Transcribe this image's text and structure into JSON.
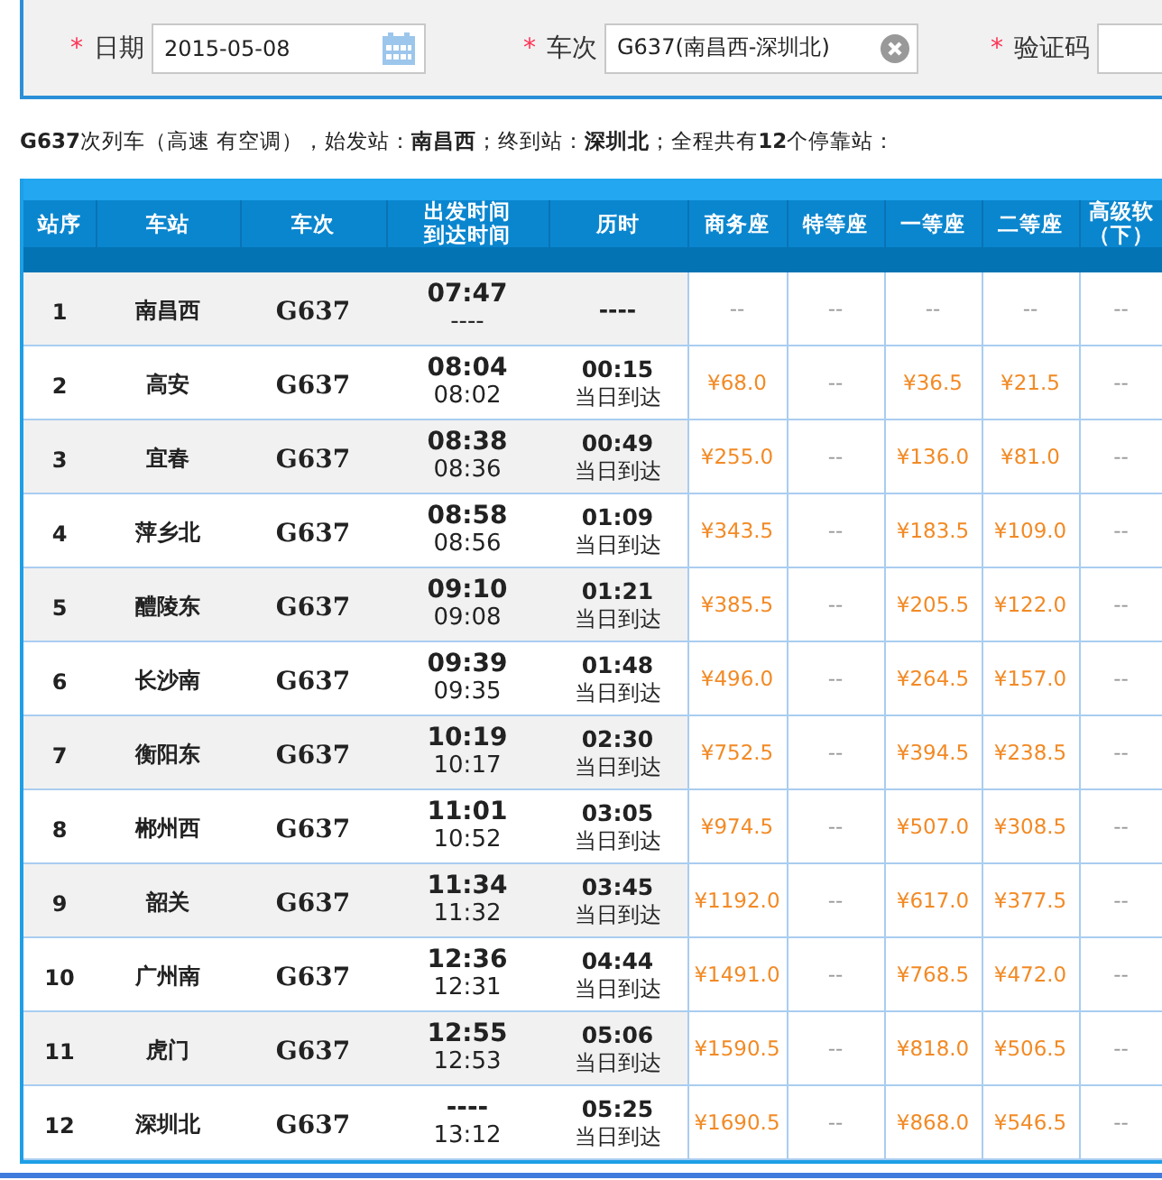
{
  "search_form": {
    "fields": [
      {
        "kind": "date",
        "label": "日期",
        "required_mark": "*",
        "value": "2015-05-08"
      },
      {
        "kind": "select",
        "label": "车次",
        "required_mark": "*",
        "value": "G637(南昌西-深圳北)"
      },
      {
        "kind": "captcha",
        "label": "验证码",
        "required_mark": "*"
      }
    ]
  },
  "summary": "**G637**次列车（高速 有空调），始发站：**南昌西**；终到站：**深圳北**；全程共有**12**个停靠站：",
  "table": {
    "columns": [
      {
        "label": "站序"
      },
      {
        "label": "车站"
      },
      {
        "label": "车次"
      },
      {
        "label": "出发时间",
        "label_2": "到达时间"
      },
      {
        "label": "历时"
      },
      {
        "label": "商务座"
      },
      {
        "label": "特等座"
      },
      {
        "label": "一等座"
      },
      {
        "label": "二等座"
      },
      {
        "label": "高级软",
        "label_2": "（下）"
      }
    ],
    "rows": [
      {
        "seq": "1",
        "station": "南昌西",
        "train": "G637",
        "depart": "07:47",
        "arrive": "----",
        "duration": "----",
        "prices": [
          {
            "text": "--",
            "available": false
          },
          {
            "text": "--",
            "available": false
          },
          {
            "text": "--",
            "available": false
          },
          {
            "text": "--",
            "available": false
          },
          {
            "text": "--",
            "available": false
          }
        ]
      },
      {
        "seq": "2",
        "station": "高安",
        "train": "G637",
        "depart": "08:04",
        "arrive": "08:02",
        "duration": "00:15",
        "note": "当日到达",
        "prices": [
          {
            "text": "¥68.0",
            "available": true
          },
          {
            "text": "--",
            "available": false
          },
          {
            "text": "¥36.5",
            "available": true
          },
          {
            "text": "¥21.5",
            "available": true
          },
          {
            "text": "--",
            "available": false
          }
        ]
      },
      {
        "seq": "3",
        "station": "宜春",
        "train": "G637",
        "depart": "08:38",
        "arrive": "08:36",
        "duration": "00:49",
        "note": "当日到达",
        "prices": [
          {
            "text": "¥255.0",
            "available": true
          },
          {
            "text": "--",
            "available": false
          },
          {
            "text": "¥136.0",
            "available": true
          },
          {
            "text": "¥81.0",
            "available": true
          },
          {
            "text": "--",
            "available": false
          }
        ]
      },
      {
        "seq": "4",
        "station": "萍乡北",
        "train": "G637",
        "depart": "08:58",
        "arrive": "08:56",
        "duration": "01:09",
        "note": "当日到达",
        "prices": [
          {
            "text": "¥343.5",
            "available": true
          },
          {
            "text": "--",
            "available": false
          },
          {
            "text": "¥183.5",
            "available": true
          },
          {
            "text": "¥109.0",
            "available": true
          },
          {
            "text": "--",
            "available": false
          }
        ]
      },
      {
        "seq": "5",
        "station": "醴陵东",
        "train": "G637",
        "depart": "09:10",
        "arrive": "09:08",
        "duration": "01:21",
        "note": "当日到达",
        "prices": [
          {
            "text": "¥385.5",
            "available": true
          },
          {
            "text": "--",
            "available": false
          },
          {
            "text": "¥205.5",
            "available": true
          },
          {
            "text": "¥122.0",
            "available": true
          },
          {
            "text": "--",
            "available": false
          }
        ]
      },
      {
        "seq": "6",
        "station": "长沙南",
        "train": "G637",
        "depart": "09:39",
        "arrive": "09:35",
        "duration": "01:48",
        "note": "当日到达",
        "prices": [
          {
            "text": "¥496.0",
            "available": true
          },
          {
            "text": "--",
            "available": false
          },
          {
            "text": "¥264.5",
            "available": true
          },
          {
            "text": "¥157.0",
            "available": true
          },
          {
            "text": "--",
            "available": false
          }
        ]
      },
      {
        "seq": "7",
        "station": "衡阳东",
        "train": "G637",
        "depart": "10:19",
        "arrive": "10:17",
        "duration": "02:30",
        "note": "当日到达",
        "prices": [
          {
            "text": "¥752.5",
            "available": true
          },
          {
            "text": "--",
            "available": false
          },
          {
            "text": "¥394.5",
            "available": true
          },
          {
            "text": "¥238.5",
            "available": true
          },
          {
            "text": "--",
            "available": false
          }
        ]
      },
      {
        "seq": "8",
        "station": "郴州西",
        "train": "G637",
        "depart": "11:01",
        "arrive": "10:52",
        "duration": "03:05",
        "note": "当日到达",
        "prices": [
          {
            "text": "¥974.5",
            "available": true
          },
          {
            "text": "--",
            "available": false
          },
          {
            "text": "¥507.0",
            "available": true
          },
          {
            "text": "¥308.5",
            "available": true
          },
          {
            "text": "--",
            "available": false
          }
        ]
      },
      {
        "seq": "9",
        "station": "韶关",
        "train": "G637",
        "depart": "11:34",
        "arrive": "11:32",
        "duration": "03:45",
        "note": "当日到达",
        "prices": [
          {
            "text": "¥1192.0",
            "available": true
          },
          {
            "text": "--",
            "available": false
          },
          {
            "text": "¥617.0",
            "available": true
          },
          {
            "text": "¥377.5",
            "available": true
          },
          {
            "text": "--",
            "available": false
          }
        ]
      },
      {
        "seq": "10",
        "station": "广州南",
        "train": "G637",
        "depart": "12:36",
        "arrive": "12:31",
        "duration": "04:44",
        "note": "当日到达",
        "prices": [
          {
            "text": "¥1491.0",
            "available": true
          },
          {
            "text": "--",
            "available": false
          },
          {
            "text": "¥768.5",
            "available": true
          },
          {
            "text": "¥472.0",
            "available": true
          },
          {
            "text": "--",
            "available": false
          }
        ]
      },
      {
        "seq": "11",
        "station": "虎门",
        "train": "G637",
        "depart": "12:55",
        "arrive": "12:53",
        "duration": "05:06",
        "note": "当日到达",
        "prices": [
          {
            "text": "¥1590.5",
            "available": true
          },
          {
            "text": "--",
            "available": false
          },
          {
            "text": "¥818.0",
            "available": true
          },
          {
            "text": "¥506.5",
            "available": true
          },
          {
            "text": "--",
            "available": false
          }
        ]
      },
      {
        "seq": "12",
        "station": "深圳北",
        "train": "G637",
        "depart": "----",
        "arrive": "13:12",
        "duration": "05:25",
        "note": "当日到达",
        "prices": [
          {
            "text": "¥1690.5",
            "available": true
          },
          {
            "text": "--",
            "available": false
          },
          {
            "text": "¥868.0",
            "available": true
          },
          {
            "text": "¥546.5",
            "available": true
          },
          {
            "text": "--",
            "available": false
          }
        ]
      }
    ]
  }
}
